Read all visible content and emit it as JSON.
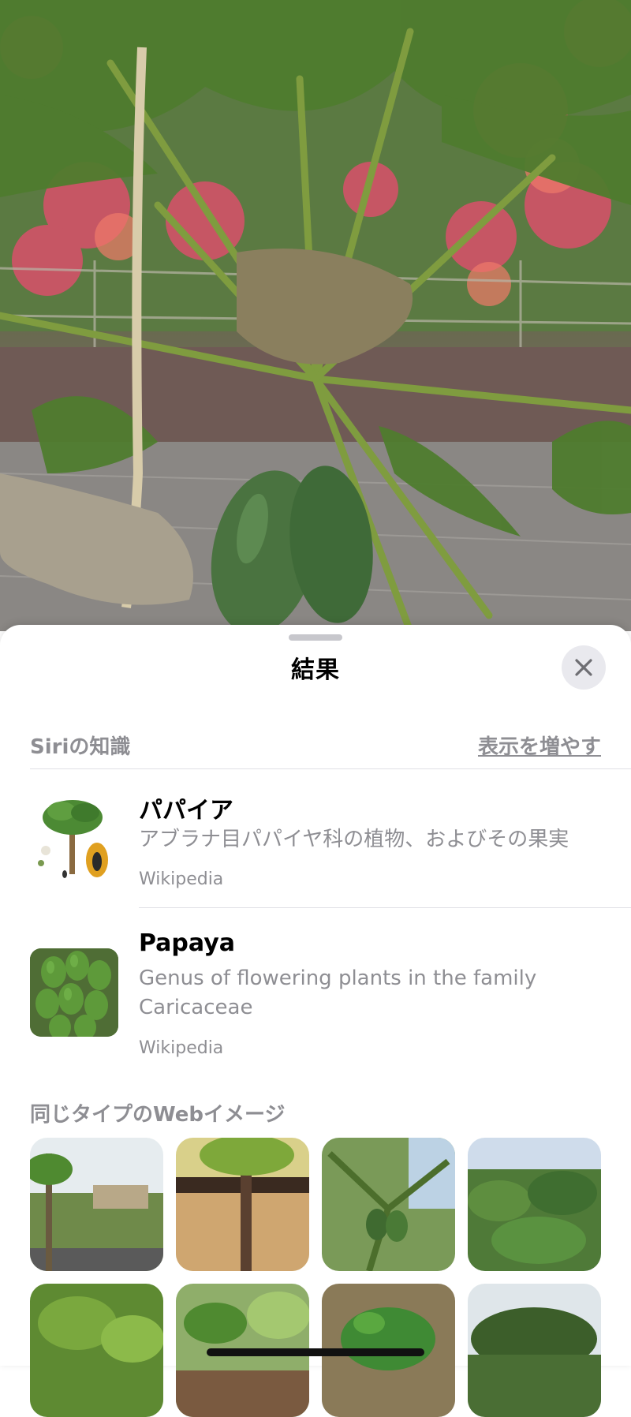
{
  "sheet": {
    "title": "結果",
    "close_icon": "close-icon"
  },
  "knowledge": {
    "header": "Siriの知識",
    "more_label": "表示を増やす"
  },
  "results": [
    {
      "title": "パパイア",
      "description": "アブラナ目パパイヤ科の植物、およびその果実",
      "source": "Wikipedia",
      "thumbnail": "papaya-illustration-icon"
    },
    {
      "title": "Papaya",
      "description": "Genus of flowering plants in the family Caricaceae",
      "source": "Wikipedia",
      "thumbnail": "papaya-fruit-photo"
    }
  ],
  "web_images": {
    "header": "同じタイプのWebイメージ"
  }
}
